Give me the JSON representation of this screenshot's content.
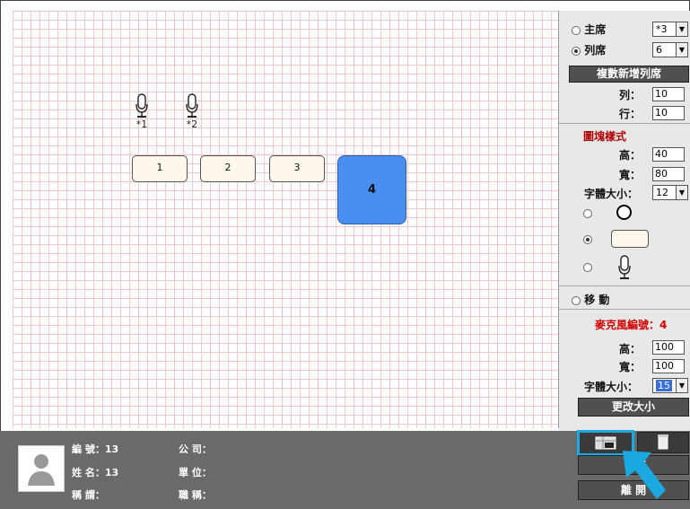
{
  "canvas": {
    "mics": [
      {
        "label": "*1"
      },
      {
        "label": "*2"
      }
    ],
    "seats": [
      {
        "label": "1"
      },
      {
        "label": "2"
      },
      {
        "label": "3"
      },
      {
        "label": "4"
      }
    ]
  },
  "panel": {
    "chair_label": "主席",
    "chair_value": "*3",
    "row_seat_label": "列席",
    "row_seat_value": "6",
    "copy_add_button": "複數新增列席",
    "cols_label": "列：",
    "cols_value": "10",
    "rows_label": "行：",
    "rows_value": "10",
    "block_style_title": "圖塊樣式",
    "height_label": "高：",
    "height_value": "40",
    "width_label": "寬：",
    "width_value": "80",
    "font_size_label": "字體大小：",
    "font_size_value": "12",
    "move_label": "移 動",
    "mic_number_title": "麥克風編號：4",
    "mic_height_label": "高：",
    "mic_height_value": "100",
    "mic_width_label": "寬：",
    "mic_width_value": "100",
    "mic_font_label": "字體大小：",
    "mic_font_value": "15",
    "resize_button": "更改大小",
    "exit_button": "離 開",
    "save_button_partial": "存"
  },
  "bottom": {
    "number_label": "編 號：13",
    "name_label": "姓 名：13",
    "title_label": "稱 謂：",
    "company_label": "公 司：",
    "unit_label": "單 位：",
    "position_label": "職 稱："
  },
  "colors": {
    "accent": "#4a8ff0",
    "panel_bg": "#e8e8e8",
    "bottom_bg": "#6a6a6a",
    "highlight_arrow": "#1aa9e0"
  }
}
